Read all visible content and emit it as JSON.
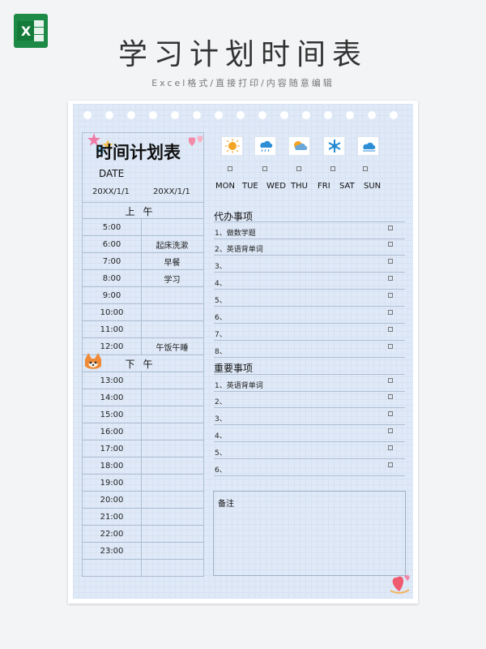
{
  "header": {
    "title": "学习计划时间表",
    "subtitle": "Excel格式/直接打印/内容随意编辑",
    "logo_text": "X"
  },
  "planner": {
    "heading": "时间计划表",
    "date_label": "DATE",
    "date_from": "20XX/1/1",
    "date_to": "20XX/1/1",
    "morning_label": "上午",
    "afternoon_label": "下午",
    "weather_icons": [
      "sun-icon",
      "rain-cloud-icon",
      "partly-cloudy-icon",
      "snowflake-icon",
      "cloud-icon"
    ],
    "days": [
      "MON",
      "TUE",
      "WED",
      "THU",
      "FRI",
      "SAT",
      "SUN"
    ],
    "morning": [
      {
        "time": "5:00",
        "activity": ""
      },
      {
        "time": "6:00",
        "activity": "起床洗漱"
      },
      {
        "time": "7:00",
        "activity": "早餐"
      },
      {
        "time": "8:00",
        "activity": "学习"
      },
      {
        "time": "9:00",
        "activity": ""
      },
      {
        "time": "10:00",
        "activity": ""
      },
      {
        "time": "11:00",
        "activity": ""
      },
      {
        "time": "12:00",
        "activity": "午饭午睡"
      }
    ],
    "afternoon": [
      {
        "time": "13:00",
        "activity": ""
      },
      {
        "time": "14:00",
        "activity": ""
      },
      {
        "time": "15:00",
        "activity": ""
      },
      {
        "time": "16:00",
        "activity": ""
      },
      {
        "time": "17:00",
        "activity": ""
      },
      {
        "time": "18:00",
        "activity": ""
      },
      {
        "time": "19:00",
        "activity": ""
      },
      {
        "time": "20:00",
        "activity": ""
      },
      {
        "time": "21:00",
        "activity": ""
      },
      {
        "time": "22:00",
        "activity": ""
      },
      {
        "time": "23:00",
        "activity": ""
      },
      {
        "time": "",
        "activity": ""
      }
    ],
    "todo_title": "代办事项",
    "todos": [
      "1、做数学题",
      "2、英语背单词",
      "3、",
      "4、",
      "5、",
      "6、",
      "7、",
      "8、"
    ],
    "important_title": "重要事项",
    "important": [
      "1、英语背单词",
      "2、",
      "3、",
      "4、",
      "5、",
      "6、"
    ],
    "notes_label": "备注"
  },
  "colors": {
    "paper": "#dfe9f7",
    "grid_lines": "#aebfd4",
    "brand": "#1d8a47"
  }
}
